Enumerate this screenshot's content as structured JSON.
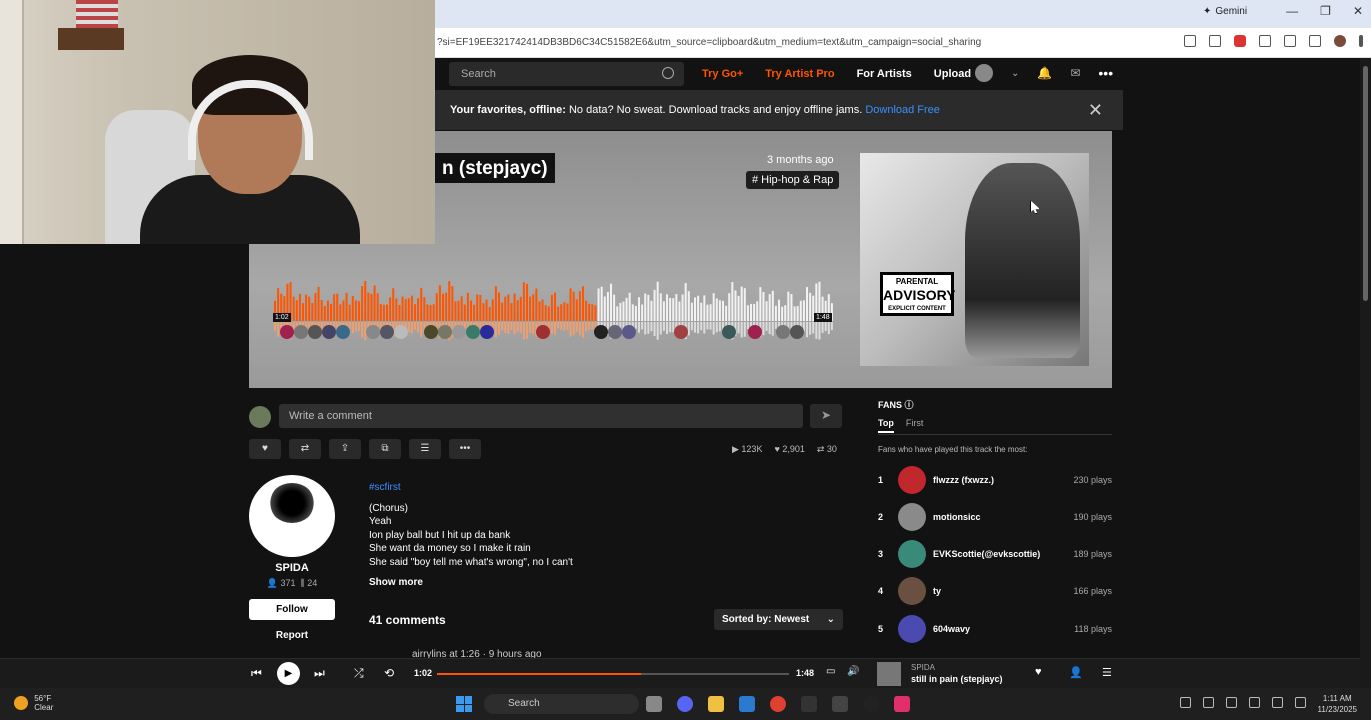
{
  "browser": {
    "gemini_label": "Gemini",
    "url": "?si=EF19EE321742414DB3BD6C34C51582E6&utm_source=clipboard&utm_medium=text&utm_campaign=social_sharing"
  },
  "header": {
    "search_placeholder": "Search",
    "nav": [
      "Try Go+",
      "Try Artist Pro",
      "For Artists",
      "Upload"
    ]
  },
  "banner": {
    "bold": "Your favorites, offline:",
    "text": " No data? No sweat. Download tracks and enjoy offline jams. ",
    "link": "Download Free"
  },
  "track": {
    "title_visible": "n (stepjayc)",
    "time_ago": "3 months ago",
    "genre": "# Hip-hop & Rap",
    "advisory_top": "PARENTAL",
    "advisory_mid": "ADVISORY",
    "advisory_bottom": "EXPLICIT CONTENT",
    "wave_current": "1:02",
    "wave_total": "1:48"
  },
  "comment": {
    "placeholder": "Write a comment"
  },
  "stats": {
    "plays": "123K",
    "likes": "2,901",
    "reposts": "30"
  },
  "artist": {
    "name": "SPIDA",
    "followers": "371",
    "tracks": "24",
    "follow_label": "Follow",
    "report_label": "Report"
  },
  "description": {
    "hashtag": "#scfirst",
    "lines": [
      "(Chorus)",
      "Yeah",
      "Ion play ball but I hit up da bank",
      "She want da money so I make it rain",
      "She said \"boy tell me what's wrong\", no I can't"
    ],
    "show_more": "Show more"
  },
  "comments": {
    "count_label": "41 comments",
    "sort_label": "Sorted by: Newest",
    "first_partial": "airrylins at 1:26 · 9 hours ago"
  },
  "fans": {
    "title": "FANS",
    "tabs": [
      "Top",
      "First"
    ],
    "subtitle": "Fans who have played this track the most:",
    "list": [
      {
        "rank": "1",
        "name": "flwzzz (fxwzz.)",
        "plays": "230 plays",
        "color": "#c0282d"
      },
      {
        "rank": "2",
        "name": "motionsicc",
        "plays": "190 plays",
        "color": "#8a8a8a"
      },
      {
        "rank": "3",
        "name": "EVKScottie(@evkscottie)",
        "plays": "189 plays",
        "color": "#3a8a7a"
      },
      {
        "rank": "4",
        "name": "ty",
        "plays": "166 plays",
        "color": "#6a5040"
      },
      {
        "rank": "5",
        "name": "604wavy",
        "plays": "118 plays",
        "color": "#4a4ab0"
      }
    ]
  },
  "player": {
    "current": "1:02",
    "total": "1:48",
    "progress": 0.58,
    "artist": "SPIDA",
    "track": "still in pain (stepjayc)"
  },
  "taskbar": {
    "temp": "56°F",
    "weather": "Clear",
    "search": "Search",
    "time": "1:11 AM",
    "date": "11/23/2025"
  },
  "colors": {
    "accent": "#ff5500",
    "link": "#3b8fff"
  }
}
